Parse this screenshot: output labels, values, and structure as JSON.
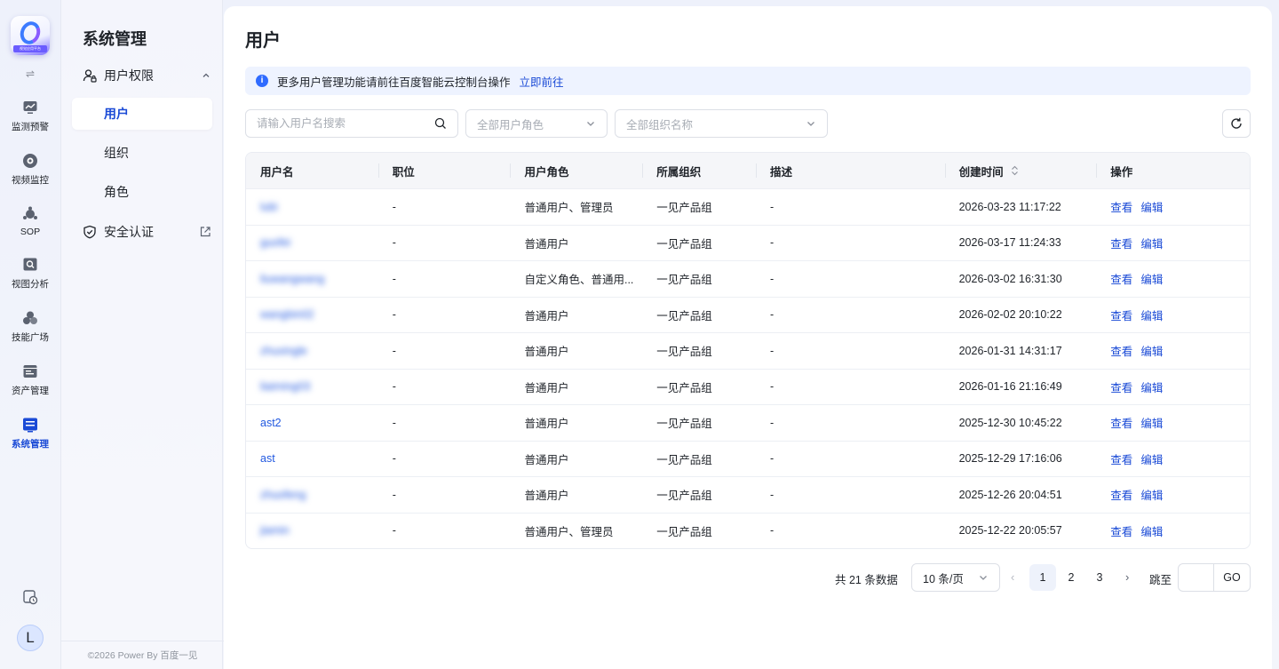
{
  "rail": {
    "logo_text": "视觉应用平台",
    "swap_glyph": "⇌",
    "items": [
      {
        "label": "监测预警",
        "icon": "monitor-chart-icon"
      },
      {
        "label": "视频监控",
        "icon": "camera-icon"
      },
      {
        "label": "SOP",
        "icon": "sop-icon"
      },
      {
        "label": "视图分析",
        "icon": "view-analysis-icon"
      },
      {
        "label": "技能广场",
        "icon": "skills-icon"
      },
      {
        "label": "资产管理",
        "icon": "asset-icon"
      },
      {
        "label": "系统管理",
        "icon": "system-icon",
        "active": true
      }
    ],
    "avatar_letter": "L"
  },
  "subnav": {
    "title": "系统管理",
    "group_label": "用户权限",
    "items": [
      "用户",
      "组织",
      "角色"
    ],
    "security_label": "安全认证",
    "copyright": "©2026 Power By 百度一见"
  },
  "main": {
    "title": "用户",
    "notice_text": "更多用户管理功能请前往百度智能云控制台操作",
    "notice_link": "立即前往",
    "search_placeholder": "请输入用户名搜索",
    "role_placeholder": "全部用户角色",
    "org_placeholder": "全部组织名称"
  },
  "table": {
    "headers": [
      "用户名",
      "职位",
      "用户角色",
      "所属组织",
      "描述",
      "创建时间",
      "操作"
    ],
    "action_view": "查看",
    "action_edit": "编辑",
    "rows": [
      {
        "username": "lubi",
        "position": "-",
        "role": "普通用户、管理员",
        "org": "一见产品组",
        "desc": "-",
        "created": "2026-03-23 11:17:22"
      },
      {
        "username": "guofei",
        "position": "-",
        "role": "普通用户",
        "org": "一见产品组",
        "desc": "-",
        "created": "2026-03-17 11:24:33"
      },
      {
        "username": "liuwangwang",
        "position": "-",
        "role": "自定义角色、普通用...",
        "org": "一见产品组",
        "desc": "-",
        "created": "2026-03-02 16:31:30"
      },
      {
        "username": "wangbin02",
        "position": "-",
        "role": "普通用户",
        "org": "一见产品组",
        "desc": "-",
        "created": "2026-02-02 20:10:22"
      },
      {
        "username": "zhuxingle",
        "position": "-",
        "role": "普通用户",
        "org": "一见产品组",
        "desc": "-",
        "created": "2026-01-31 14:31:17"
      },
      {
        "username": "liaiming03",
        "position": "-",
        "role": "普通用户",
        "org": "一见产品组",
        "desc": "-",
        "created": "2026-01-16 21:16:49"
      },
      {
        "username": "ast2",
        "position": "-",
        "role": "普通用户",
        "org": "一见产品组",
        "desc": "-",
        "created": "2025-12-30 10:45:22"
      },
      {
        "username": "ast",
        "position": "-",
        "role": "普通用户",
        "org": "一见产品组",
        "desc": "-",
        "created": "2025-12-29 17:16:06"
      },
      {
        "username": "zhuofeng",
        "position": "-",
        "role": "普通用户",
        "org": "一见产品组",
        "desc": "-",
        "created": "2025-12-26 20:04:51"
      },
      {
        "username": "jiamin",
        "position": "-",
        "role": "普通用户、管理员",
        "org": "一见产品组",
        "desc": "-",
        "created": "2025-12-22 20:05:57"
      }
    ]
  },
  "pagination": {
    "total_text": "共 21 条数据",
    "page_size": "10 条/页",
    "pages": [
      "1",
      "2",
      "3"
    ],
    "current": "1",
    "jump_label": "跳至",
    "go_label": "GO"
  },
  "colors": {
    "primary": "#1a4ad6",
    "link": "#2259e0",
    "notice_bg": "#eef3ff"
  }
}
